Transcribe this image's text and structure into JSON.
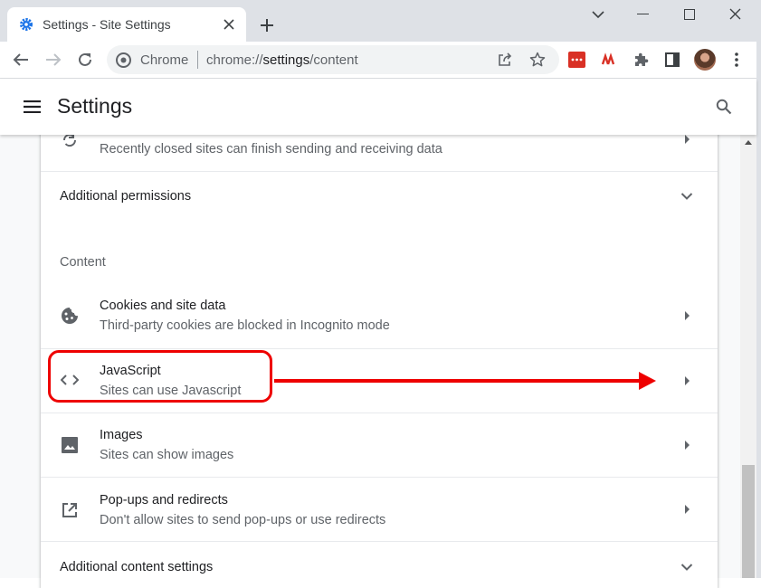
{
  "browser": {
    "tab_title": "Settings - Site Settings",
    "site_label": "Chrome",
    "url_prefix": "chrome://",
    "url_highlight": "settings",
    "url_suffix": "/content",
    "extension_badge_color": "#d93025"
  },
  "header": {
    "title": "Settings"
  },
  "rows": {
    "background_sync": {
      "secondary": "Recently closed sites can finish sending and receiving data"
    },
    "additional_permissions": {
      "label": "Additional permissions"
    },
    "section_content": {
      "label": "Content"
    },
    "cookies": {
      "primary": "Cookies and site data",
      "secondary": "Third-party cookies are blocked in Incognito mode"
    },
    "javascript": {
      "primary": "JavaScript",
      "secondary": "Sites can use Javascript"
    },
    "images": {
      "primary": "Images",
      "secondary": "Sites can show images"
    },
    "popups": {
      "primary": "Pop-ups and redirects",
      "secondary": "Don't allow sites to send pop-ups or use redirects"
    },
    "additional_content": {
      "label": "Additional content settings"
    }
  },
  "annotation": {
    "color": "#e00000"
  }
}
